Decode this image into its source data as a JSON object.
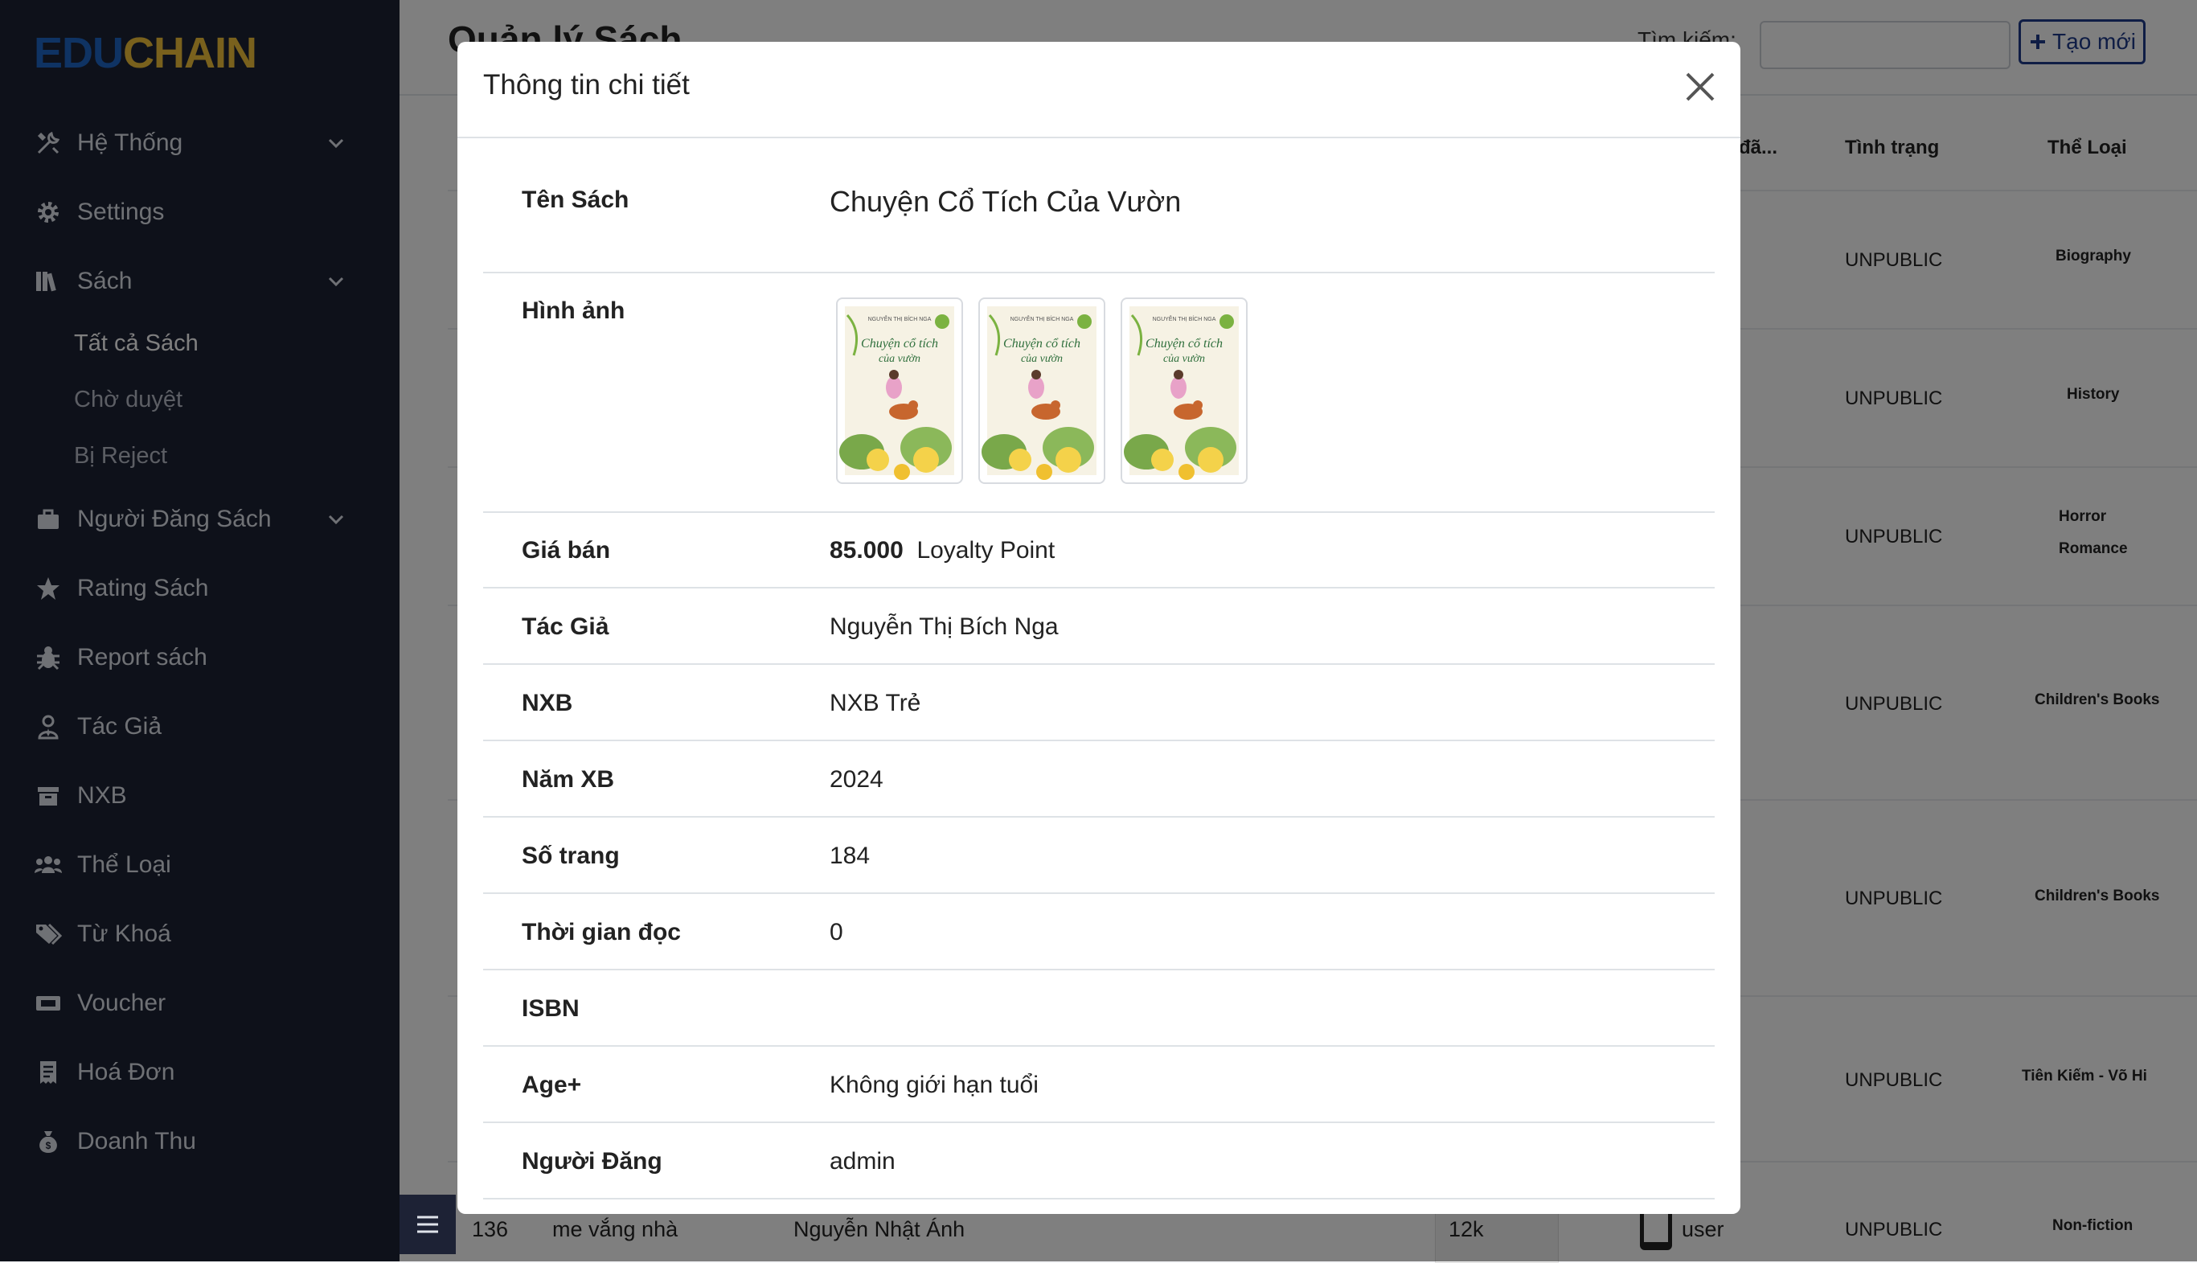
{
  "sidebar": {
    "logo_edu": "EDU",
    "logo_chain": "CHAIN",
    "items": [
      {
        "label": "Hệ Thống",
        "icon": "tools-icon"
      },
      {
        "label": "Settings",
        "icon": "gear-icon"
      },
      {
        "label": "Sách",
        "icon": "books-icon"
      },
      {
        "label": "Người Đăng Sách",
        "icon": "briefcase-icon"
      },
      {
        "label": "Rating Sách",
        "icon": "star-icon"
      },
      {
        "label": "Report sách",
        "icon": "bug-icon"
      },
      {
        "label": "Tác Giả",
        "icon": "user-tie-icon"
      },
      {
        "label": "NXB",
        "icon": "archive-icon"
      },
      {
        "label": "Thể Loại",
        "icon": "users-icon"
      },
      {
        "label": "Từ Khoá",
        "icon": "tags-icon"
      },
      {
        "label": "Voucher",
        "icon": "ticket-icon"
      },
      {
        "label": "Hoá Đơn",
        "icon": "receipt-icon"
      },
      {
        "label": "Doanh Thu",
        "icon": "money-bag-icon"
      }
    ],
    "sub_items": [
      {
        "label": "Tất cả Sách",
        "active": true
      },
      {
        "label": "Chờ duyệt",
        "active": false
      },
      {
        "label": "Bị Reject",
        "active": false
      }
    ]
  },
  "page": {
    "title": "Quản lý Sách",
    "search_label": "Tìm kiếm:",
    "search_value": "",
    "create_label": "Tạo mới",
    "headers": {
      "col_partial": "đã...",
      "status": "Tình trạng",
      "genre": "Thể Loại"
    },
    "rows": [
      {
        "status": "UNPUBLIC",
        "genres": [
          "Biography"
        ]
      },
      {
        "status": "UNPUBLIC",
        "genres": [
          "History"
        ]
      },
      {
        "status": "UNPUBLIC",
        "genres": [
          "Horror",
          "Romance"
        ]
      },
      {
        "status": "UNPUBLIC",
        "genres": [
          "Children's Books"
        ]
      },
      {
        "status": "UNPUBLIC",
        "genres": [
          "Children's Books"
        ]
      },
      {
        "status": "UNPUBLIC",
        "genres": [
          "Tiên Kiếm - Võ Hi"
        ]
      },
      {
        "status": "UNPUBLIC",
        "genres": [
          "Non-fiction"
        ]
      }
    ],
    "last_row": {
      "id": "136",
      "name": "me vắng nhà",
      "author": "Nguyễn Nhật Ánh",
      "views": "12k",
      "poster": "user"
    }
  },
  "modal": {
    "title": "Thông tin chi tiết",
    "fields": {
      "ten_sach": {
        "label": "Tên Sách",
        "value": "Chuyện Cổ Tích Của Vườn"
      },
      "hinh_anh": {
        "label": "Hình ảnh",
        "count": 3
      },
      "gia_ban": {
        "label": "Giá bán",
        "amount": "85.000",
        "unit": "Loyalty Point"
      },
      "tac_gia": {
        "label": "Tác Giả",
        "value": "Nguyễn Thị Bích Nga"
      },
      "nxb": {
        "label": "NXB",
        "value": "NXB Trẻ"
      },
      "nam_xb": {
        "label": "Năm XB",
        "value": "2024"
      },
      "so_trang": {
        "label": "Số trang",
        "value": "184"
      },
      "thoi_gian_doc": {
        "label": "Thời gian đọc",
        "value": "0"
      },
      "isbn": {
        "label": "ISBN",
        "value": ""
      },
      "age": {
        "label": "Age+",
        "value": "Không giới hạn tuổi"
      },
      "nguoi_dang": {
        "label": "Người Đăng",
        "value": "admin"
      }
    },
    "cover": {
      "author_line": "NGUYỄN THỊ BÍCH NGA",
      "title_line1": "Chuyện cổ tích",
      "title_line2": "của vườn"
    }
  },
  "colors": {
    "sidebar_bg": "#1d2235",
    "brand_blue": "#1f66c6",
    "brand_yellow": "#f2c23a",
    "create_btn": "#1f3a8a"
  }
}
